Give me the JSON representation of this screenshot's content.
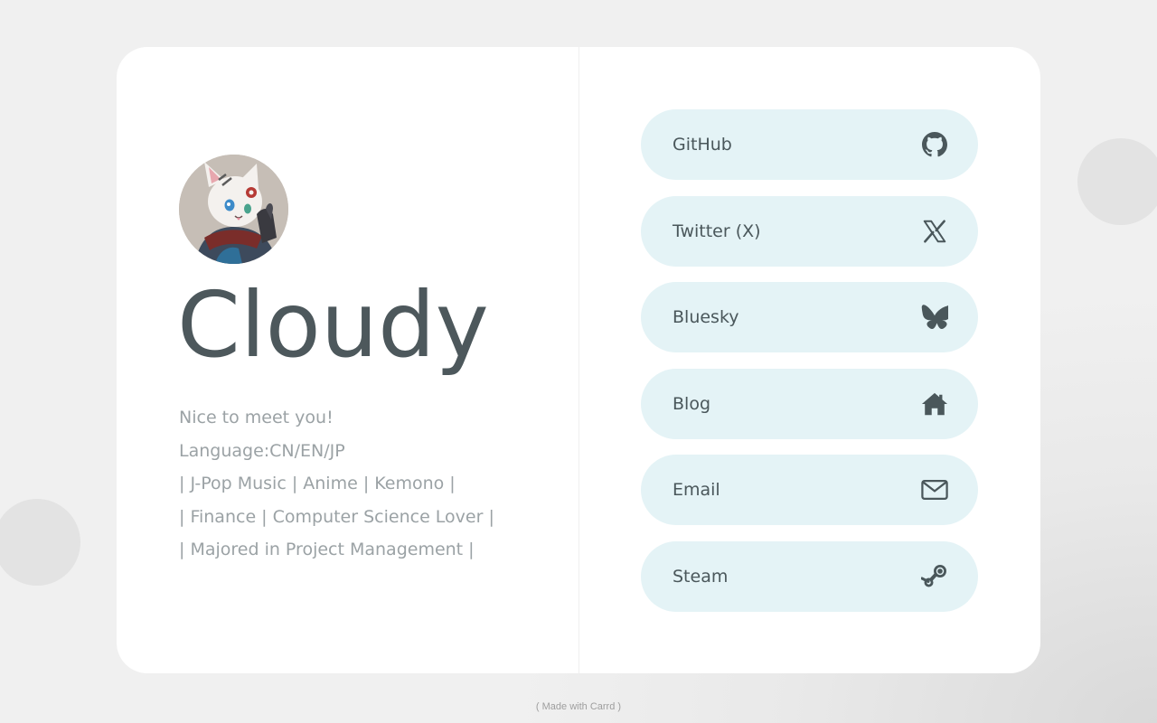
{
  "profile": {
    "name": "Cloudy",
    "bio": [
      "Nice to meet you!",
      "Language:CN/EN/JP",
      "| J-Pop Music | Anime | Kemono |",
      "| Finance | Computer Science Lover |",
      "| Majored in Project Management |"
    ]
  },
  "links": [
    {
      "label": "GitHub",
      "icon": "github-icon"
    },
    {
      "label": "Twitter (X)",
      "icon": "x-icon"
    },
    {
      "label": "Bluesky",
      "icon": "butterfly-icon"
    },
    {
      "label": "Blog",
      "icon": "home-icon"
    },
    {
      "label": "Email",
      "icon": "envelope-icon"
    },
    {
      "label": "Steam",
      "icon": "steam-icon"
    }
  ],
  "footer": {
    "text": "( Made with Carrd )"
  },
  "colors": {
    "page_background": "#efefef",
    "card_background": "#ffffff",
    "link_background": "#e4f3f6",
    "name_text": "#4d585c",
    "bio_text": "#9ba2a5",
    "link_text": "#4a575b"
  }
}
